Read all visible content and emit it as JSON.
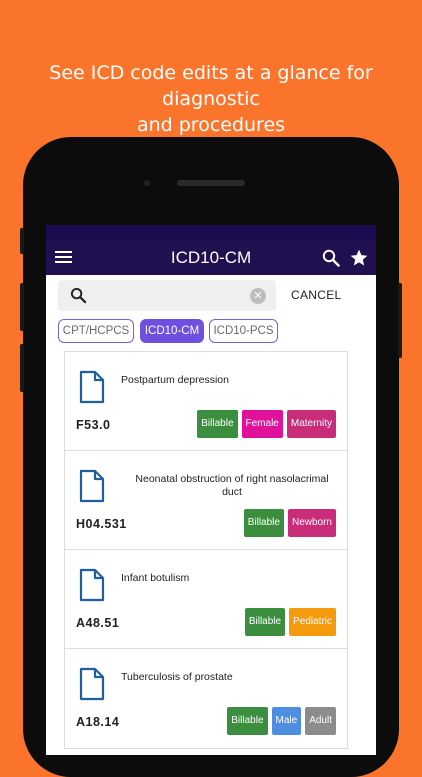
{
  "headline": {
    "line1": "See ICD code edits at a glance for diagnostic",
    "line2": "and procedures"
  },
  "appbar": {
    "title": "ICD10-CM",
    "menu_icon": "hamburger-menu-icon",
    "search_icon": "search-icon",
    "favorite_icon": "star-icon"
  },
  "search": {
    "value": "",
    "placeholder": "",
    "cancel_label": "CANCEL"
  },
  "tabs": [
    {
      "label": "CPT/HCPCS",
      "active": false
    },
    {
      "label": "ICD10-CM",
      "active": true
    },
    {
      "label": "ICD10-PCS",
      "active": false
    }
  ],
  "colors": {
    "background": "#FA742B",
    "appbar": "#21104F",
    "tab_active": "#6E4FE0",
    "billable": "#3A8E3E",
    "female": "#E0119A",
    "maternity": "#C92C78",
    "newborn": "#C92C78",
    "pediatric": "#F59A0C",
    "male": "#4E8EE0",
    "adult": "#8C8C8C"
  },
  "results": [
    {
      "description": "Postpartum depression",
      "code": "F53.0",
      "badges": [
        {
          "label": "Billable",
          "color": "#3A8E3E"
        },
        {
          "label": "Female",
          "color": "#E0119A"
        },
        {
          "label": "Maternity",
          "color": "#C92C78"
        }
      ]
    },
    {
      "description": "Neonatal obstruction of right nasolacrimal duct",
      "code": "H04.531",
      "badges": [
        {
          "label": "Billable",
          "color": "#3A8E3E"
        },
        {
          "label": "Newborn",
          "color": "#C92C78"
        }
      ]
    },
    {
      "description": "Infant botulism",
      "code": "A48.51",
      "badges": [
        {
          "label": "Billable",
          "color": "#3A8E3E"
        },
        {
          "label": "Pediatric",
          "color": "#F59A0C"
        }
      ]
    },
    {
      "description": "Tuberculosis of prostate",
      "code": "A18.14",
      "badges": [
        {
          "label": "Billable",
          "color": "#3A8E3E"
        },
        {
          "label": "Male",
          "color": "#4E8EE0"
        },
        {
          "label": "Adult",
          "color": "#8C8C8C"
        }
      ]
    }
  ]
}
